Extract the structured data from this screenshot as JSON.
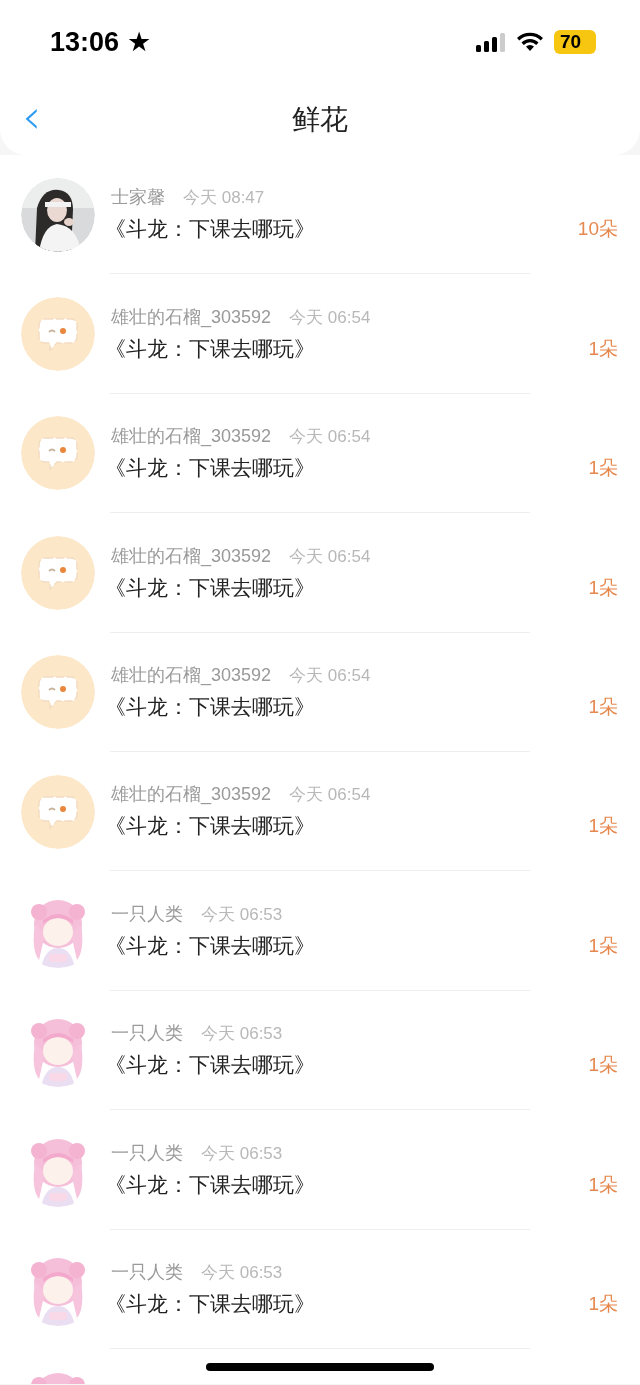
{
  "status_bar": {
    "time": "13:06",
    "star": "★",
    "battery": "70"
  },
  "nav": {
    "back": "‹",
    "title": "鲜花"
  },
  "rows": [
    {
      "name": "士家馨",
      "time": "今天 08:47",
      "title": "《斗龙：下课去哪玩》",
      "count": "10朵"
    },
    {
      "avatar": {
        "kind": "default"
      },
      "name": "雄壮的石榴_303592",
      "time": "今天 06:54",
      "title": "《斗龙：下课去哪玩》",
      "count": "1朵"
    },
    {
      "avatar": {
        "kind": "default"
      },
      "name": "雄壮的石榴_303592",
      "time": "今天 06:54",
      "title": "《斗龙：下课去哪玩》",
      "count": "1朵"
    },
    {
      "avatar": {
        "kind": "default"
      },
      "name": "雄壮的石榴_303592",
      "time": "今天 06:54",
      "title": "《斗龙：下课去哪玩》",
      "count": "1朵"
    },
    {
      "avatar": {
        "kind": "default"
      },
      "name": "雄壮的石榴_303592",
      "time": "今天 06:54",
      "title": "《斗龙：下课去哪玩》",
      "count": "1朵"
    },
    {
      "avatar": {
        "kind": "default"
      },
      "name": "雄壮的石榴_303592",
      "time": "今天 06:54",
      "title": "《斗龙：下课去哪玩》",
      "count": "1朵"
    },
    {
      "avatar": {
        "kind": "anime"
      },
      "name": "一只人类",
      "time": "今天 06:53",
      "title": "《斗龙：下课去哪玩》",
      "count": "1朵"
    },
    {
      "avatar": {
        "kind": "anime"
      },
      "name": "一只人类",
      "time": "今天 06:53",
      "title": "《斗龙：下课去哪玩》",
      "count": "1朵"
    },
    {
      "avatar": {
        "kind": "anime"
      },
      "name": "一只人类",
      "time": "今天 06:53",
      "title": "《斗龙：下课去哪玩》",
      "count": "1朵"
    },
    {
      "avatar": {
        "kind": "anime"
      },
      "name": "一只人类",
      "time": "今天 06:53",
      "title": "《斗龙：下课去哪玩》",
      "count": "1朵"
    },
    {
      "avatar": {
        "kind": "anime"
      }
    }
  ]
}
